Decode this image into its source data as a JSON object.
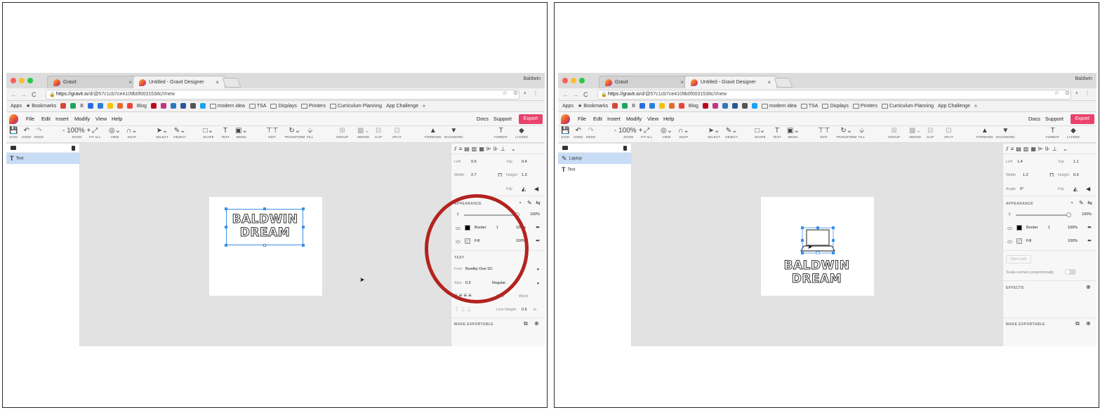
{
  "browser": {
    "tab_inactive": "Gravit",
    "tab_active": "Untitled - Gravit Designer",
    "tab_close": "×",
    "profile": "Baldwin",
    "url_host": "https://gravit.io",
    "url_path": "/d/@57c1cb7ce4109b0f0031538c/!/new",
    "nav_back": "←",
    "nav_forward": "→",
    "nav_reload": "C",
    "lock": "🔒",
    "addr_icons": "☆ ⊙ ◐ ⋮",
    "bookmarks": [
      {
        "type": "text",
        "label": "Apps"
      },
      {
        "type": "text",
        "label": "★ Bookmarks"
      },
      {
        "type": "icon",
        "color": "#d44638"
      },
      {
        "type": "icon",
        "color": "#1fa463"
      },
      {
        "type": "text",
        "label": "B"
      },
      {
        "type": "icon",
        "color": "#2d6cdf"
      },
      {
        "type": "icon",
        "color": "#2a7fd4"
      },
      {
        "type": "icon",
        "color": "#f4c20d"
      },
      {
        "type": "icon",
        "color": "#e36b2e"
      },
      {
        "type": "icon",
        "color": "#e8443a"
      },
      {
        "type": "text",
        "label": "Blog"
      },
      {
        "type": "icon",
        "color": "#bd081c"
      },
      {
        "type": "icon",
        "color": "#c13584"
      },
      {
        "type": "icon",
        "color": "#2e77bc"
      },
      {
        "type": "icon",
        "color": "#2b579a"
      },
      {
        "type": "icon",
        "color": "#555"
      },
      {
        "type": "icon",
        "color": "#1da1f2"
      },
      {
        "type": "folder",
        "label": "modern idea"
      },
      {
        "type": "folder",
        "label": "TSA"
      },
      {
        "type": "folder",
        "label": "Displays"
      },
      {
        "type": "folder",
        "label": "Printers"
      },
      {
        "type": "folder",
        "label": "Curriculum Planning"
      },
      {
        "type": "text",
        "label": "App Challenge"
      },
      {
        "type": "text",
        "label": "»"
      }
    ]
  },
  "menubar": {
    "items": [
      "File",
      "Edit",
      "Insert",
      "Modify",
      "View",
      "Help"
    ],
    "right": [
      "Docs",
      "Support"
    ],
    "export": "Export"
  },
  "toolbar": {
    "tools": [
      {
        "icon": "💾",
        "label": "SAVE"
      },
      {
        "icon": "↶",
        "label": "UNDO"
      },
      {
        "icon": "↷",
        "label": "REDO",
        "faded": true
      },
      {
        "icon": "- 100% +",
        "label": "ZOOM"
      },
      {
        "icon": "⤢",
        "label": "FIT ALL"
      },
      {
        "icon": "◎⌄",
        "label": "VIEW"
      },
      {
        "icon": "∩⌄",
        "label": "SNAP"
      },
      {
        "icon": "➤⌄",
        "label": "SELECT"
      },
      {
        "icon": "✎⌄",
        "label": "OBJECT"
      },
      {
        "icon": "□⌄",
        "label": "SHAPE"
      },
      {
        "icon": "T",
        "label": "TEXT"
      },
      {
        "icon": "▣⌄",
        "label": "MEDIA"
      },
      {
        "icon": "⊤⊤",
        "label": "EDIT"
      },
      {
        "icon": "↻⌄",
        "label": "TRANSFORM"
      },
      {
        "icon": "⬙",
        "label": "FILL",
        "faded": true
      },
      {
        "icon": "⊞",
        "label": "GROUP",
        "faded": true
      },
      {
        "icon": "▩⌄",
        "label": "MERGE",
        "faded": true
      },
      {
        "icon": "⊟",
        "label": "CLIP",
        "faded": true
      },
      {
        "icon": "⊡",
        "label": "SPLIT",
        "faded": true
      },
      {
        "icon": "▲",
        "label": "FORWARD"
      },
      {
        "icon": "▼",
        "label": "BACKWARD"
      },
      {
        "icon": "T",
        "label": "FORMAT"
      },
      {
        "icon": "◆",
        "label": "LAYERS"
      }
    ]
  },
  "canvas_text": {
    "line1": "BALDWIN",
    "line2": "DREAM"
  },
  "left_panel": {
    "layers": [
      {
        "icon": "T",
        "label": "Text",
        "selected": true
      }
    ],
    "inspector": {
      "left_label": "Left",
      "left_value": "0.6",
      "top_label": "Top",
      "top_value": "0.4",
      "width_label": "Width",
      "width_value": "2.7",
      "height_label": "Height",
      "height_value": "1.3",
      "flip_label": "Flip",
      "appearance": "APPEARANCE",
      "opacity": "100%",
      "border_label": "Border",
      "border_width": "1",
      "border_opacity": "100%",
      "fill_label": "Fill",
      "fill_opacity": "100%",
      "text_section": "TEXT",
      "font_label": "Font",
      "font_value": "Bowlby One SC",
      "size_label": "Size",
      "size_value": "0.5",
      "weight_value": "Regular",
      "char_label": "Char",
      "word_label": "Word",
      "lineheight_label": "Line-Height",
      "lineheight_value": "0.5",
      "lineheight_unit": "in",
      "exportable": "MAKE EXPORTABLE"
    }
  },
  "right_panel": {
    "layers": [
      {
        "icon": "✎",
        "label": "Laptop",
        "selected": true
      },
      {
        "icon": "T",
        "label": "Text",
        "selected": false
      }
    ],
    "inspector": {
      "left_label": "Left",
      "left_value": "1.4",
      "top_label": "Top",
      "top_value": "1.1",
      "width_label": "Width",
      "width_value": "1.2",
      "height_label": "Height",
      "height_value": "0.9",
      "angle_label": "Angle",
      "angle_value": "0°",
      "flip_label": "Flip",
      "appearance": "APPEARANCE",
      "opacity": "100%",
      "border_label": "Border",
      "border_width": "1",
      "border_opacity": "100%",
      "fill_label": "Fill",
      "fill_opacity": "100%",
      "open_path": "Open path",
      "scale_corners": "Scale corners proportionally",
      "effects": "EFFECTS",
      "exportable": "MAKE EXPORTABLE"
    }
  },
  "colors": {
    "accent": "#e8436d",
    "selection": "#3b8fe8",
    "annotation": "#b3231f",
    "layer_selected": "#c8dcf6"
  }
}
